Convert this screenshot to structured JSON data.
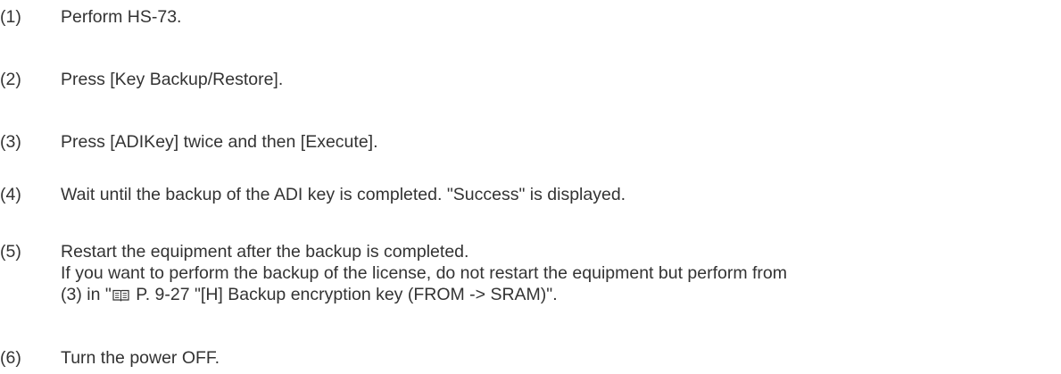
{
  "steps": [
    {
      "number": "(1)",
      "lines": [
        "Perform HS-73."
      ]
    },
    {
      "number": "(2)",
      "lines": [
        "Press [Key Backup/Restore]."
      ]
    },
    {
      "number": "(3)",
      "lines": [
        "Press [ADIKey] twice and then [Execute]."
      ]
    },
    {
      "number": "(4)",
      "lines": [
        "Wait until the backup of the ADI key is completed. \"Success\" is displayed."
      ]
    },
    {
      "number": "(5)",
      "lines": [
        "Restart the equipment after the backup is completed.",
        "If you want to perform the backup of the license, do not restart the equipment but perform from"
      ],
      "ref_line": {
        "before": "(3) in \"",
        "icon": "book-reference-icon",
        "after": " P. 9-27 \"[H]  Backup encryption key (FROM -> SRAM)\"."
      }
    },
    {
      "number": "(6)",
      "lines": [
        "Turn the power OFF."
      ]
    }
  ]
}
